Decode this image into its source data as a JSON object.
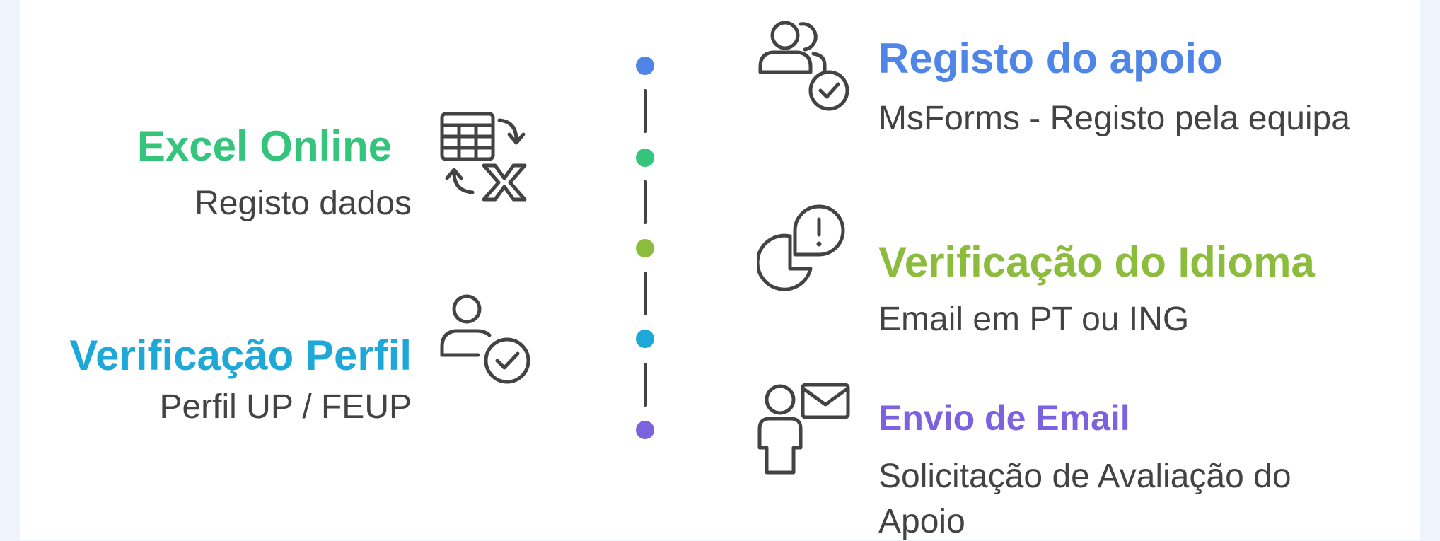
{
  "steps": [
    {
      "title": "Registo do apoio",
      "desc": "MsForms - Registo pela equipa",
      "color": "#4f85e6",
      "icon": "users-check-icon"
    },
    {
      "title": "Excel Online",
      "desc": "Registo dados",
      "color": "#34c47c",
      "icon": "spreadsheet-exchange-icon"
    },
    {
      "title": "Verificação do Idioma",
      "desc": "Email em PT ou ING",
      "color": "#8cbc3c",
      "icon": "pie-alert-icon"
    },
    {
      "title": "Verificação Perfil",
      "desc": "Perfil UP / FEUP",
      "color": "#1ea8d8",
      "icon": "user-check-icon"
    },
    {
      "title": "Envio de Email",
      "desc1": "Solicitação de Avaliação do",
      "desc2": "Apoio",
      "color": "#7d62e0",
      "icon": "user-mail-icon"
    }
  ],
  "timeline_colors": [
    "#4f85e6",
    "#34c47c",
    "#8cbc3c",
    "#1ea8d8",
    "#7d62e0"
  ]
}
